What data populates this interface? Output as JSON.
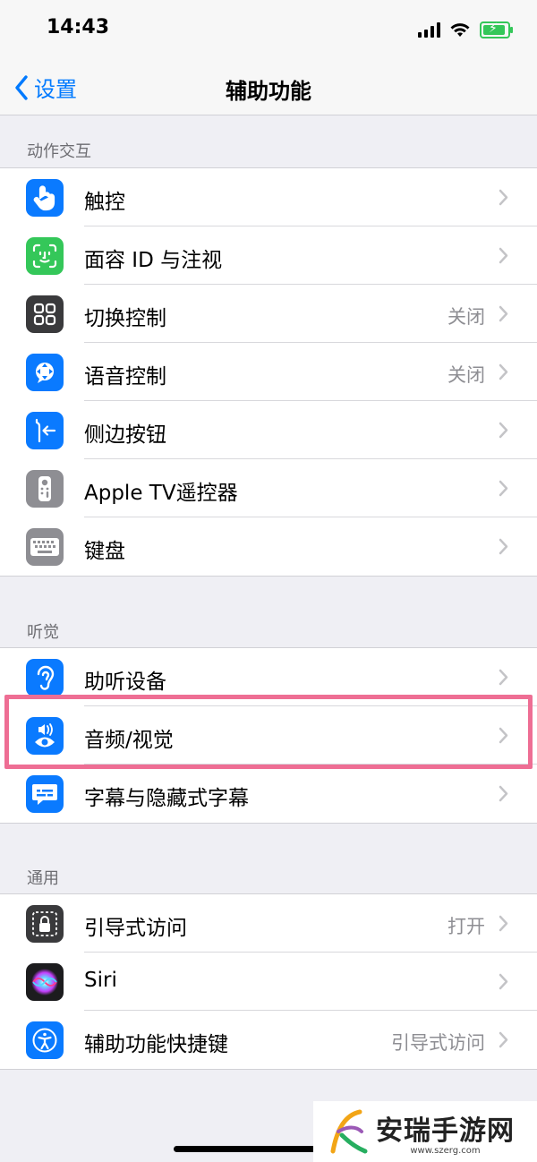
{
  "status": {
    "time": "14:43"
  },
  "nav": {
    "back_label": "设置",
    "title": "辅助功能"
  },
  "sections": [
    {
      "header": "动作交互",
      "rows": [
        {
          "label": "触控",
          "value": "",
          "icon": "touch-hand-icon",
          "color": "#0a7aff"
        },
        {
          "label": "面容 ID 与注视",
          "value": "",
          "icon": "face-id-icon",
          "color": "#34c759"
        },
        {
          "label": "切换控制",
          "value": "关闭",
          "icon": "switch-control-grid-icon",
          "color": "#3a3a3c"
        },
        {
          "label": "语音控制",
          "value": "关闭",
          "icon": "voice-control-icon",
          "color": "#0a7aff"
        },
        {
          "label": "侧边按钮",
          "value": "",
          "icon": "side-button-icon",
          "color": "#0a7aff"
        },
        {
          "label": "Apple TV遥控器",
          "value": "",
          "icon": "tv-remote-icon",
          "color": "#8e8e93"
        },
        {
          "label": "键盘",
          "value": "",
          "icon": "keyboard-icon",
          "color": "#8e8e93"
        }
      ]
    },
    {
      "header": "听觉",
      "rows": [
        {
          "label": "助听设备",
          "value": "",
          "icon": "ear-icon",
          "color": "#0a7aff"
        },
        {
          "label": "音频/视觉",
          "value": "",
          "icon": "audio-visual-icon",
          "color": "#0a7aff"
        },
        {
          "label": "字幕与隐藏式字幕",
          "value": "",
          "icon": "subtitles-icon",
          "color": "#0a7aff"
        }
      ]
    },
    {
      "header": "通用",
      "rows": [
        {
          "label": "引导式访问",
          "value": "打开",
          "icon": "guided-access-lock-icon",
          "color": "#3a3a3c"
        },
        {
          "label": "Siri",
          "value": "",
          "icon": "siri-icon",
          "color": "#1c1c1e"
        },
        {
          "label": "辅助功能快捷键",
          "value": "引导式访问",
          "icon": "accessibility-icon",
          "color": "#0a7aff"
        }
      ]
    }
  ],
  "watermark": {
    "name": "安瑞手游网",
    "url": "www.szerg.com"
  }
}
